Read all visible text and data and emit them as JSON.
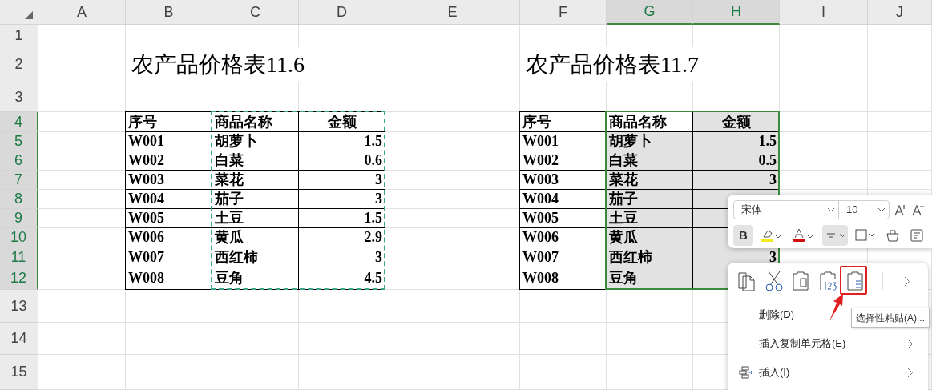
{
  "columns": [
    {
      "label": "A",
      "selected": false
    },
    {
      "label": "B",
      "selected": false
    },
    {
      "label": "C",
      "selected": false
    },
    {
      "label": "D",
      "selected": false
    },
    {
      "label": "E",
      "selected": false
    },
    {
      "label": "F",
      "selected": false
    },
    {
      "label": "G",
      "selected": true
    },
    {
      "label": "H",
      "selected": true
    },
    {
      "label": "I",
      "selected": false
    },
    {
      "label": "J",
      "selected": false
    }
  ],
  "rows": [
    {
      "label": "1",
      "selected": false
    },
    {
      "label": "2",
      "selected": false
    },
    {
      "label": "3",
      "selected": false
    },
    {
      "label": "4",
      "selected": true
    },
    {
      "label": "5",
      "selected": true
    },
    {
      "label": "6",
      "selected": true
    },
    {
      "label": "7",
      "selected": true
    },
    {
      "label": "8",
      "selected": true
    },
    {
      "label": "9",
      "selected": true
    },
    {
      "label": "10",
      "selected": true
    },
    {
      "label": "11",
      "selected": true
    },
    {
      "label": "12",
      "selected": true
    },
    {
      "label": "13",
      "selected": false
    },
    {
      "label": "14",
      "selected": false
    },
    {
      "label": "15",
      "selected": false
    }
  ],
  "tables": [
    {
      "title": "农产品价格表11.6",
      "copied": true,
      "selected": false,
      "header": [
        "序号",
        "商品名称",
        "金额"
      ],
      "rows": [
        [
          "W001",
          "胡萝卜",
          "1.5"
        ],
        [
          "W002",
          "白菜",
          "0.6"
        ],
        [
          "W003",
          "菜花",
          "3"
        ],
        [
          "W004",
          "茄子",
          "3"
        ],
        [
          "W005",
          "土豆",
          "1.5"
        ],
        [
          "W006",
          "黄瓜",
          "2.9"
        ],
        [
          "W007",
          "西红柿",
          "3"
        ],
        [
          "W008",
          "豆角",
          "4.5"
        ]
      ]
    },
    {
      "title": "农产品价格表11.7",
      "copied": false,
      "selected": true,
      "header": [
        "序号",
        "商品名称",
        "金额"
      ],
      "rows": [
        [
          "W001",
          "胡萝卜",
          "1.5"
        ],
        [
          "W002",
          "白菜",
          "0.5"
        ],
        [
          "W003",
          "菜花",
          "3"
        ],
        [
          "W004",
          "茄子"
        ],
        [
          "W005",
          "土豆"
        ],
        [
          "W006",
          "黄瓜"
        ],
        [
          "W007",
          "西红柿",
          "3"
        ],
        [
          "W008",
          "豆角"
        ]
      ]
    }
  ],
  "mini_toolbar": {
    "font": "宋体",
    "size": "10",
    "buttons": [
      {
        "kind": "bold",
        "label": "B",
        "selected": true
      },
      {
        "kind": "highlight",
        "selected": false
      },
      {
        "kind": "font-color",
        "selected": false
      },
      {
        "kind": "align",
        "selected": true
      },
      {
        "kind": "borders",
        "selected": false
      },
      {
        "kind": "format-painter",
        "selected": false
      },
      {
        "kind": "wrap",
        "selected": false
      }
    ]
  },
  "context_menu": {
    "actions": [
      {
        "kind": "copy",
        "highlighted": false
      },
      {
        "kind": "cut",
        "highlighted": false
      },
      {
        "kind": "paste",
        "highlighted": false
      },
      {
        "kind": "paste-values",
        "highlighted": false
      },
      {
        "kind": "paste-special",
        "highlighted": true
      }
    ],
    "items": [
      {
        "label": "删除(D)",
        "kind": "plain",
        "submenu": false
      },
      {
        "label": "插入复制单元格(E)",
        "kind": "plain",
        "submenu": true
      },
      {
        "label": "插入(I)",
        "kind": "insert",
        "submenu": true
      }
    ],
    "tooltip": "选择性粘贴(A)..."
  }
}
